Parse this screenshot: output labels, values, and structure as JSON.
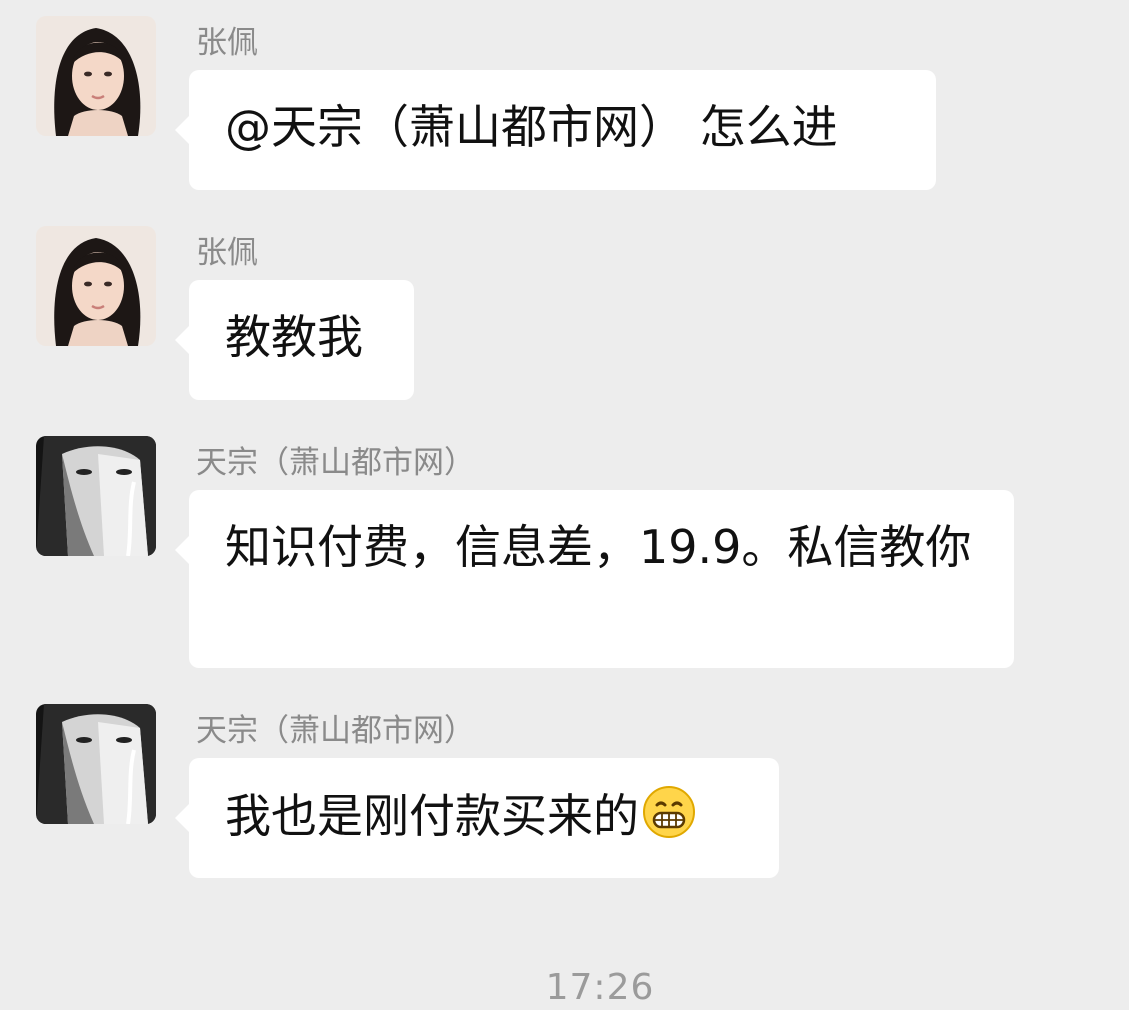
{
  "chat": {
    "messages": [
      {
        "sender": "张佩",
        "avatar": "female-avatar",
        "text": "@天宗（萧山都市网） 怎么进"
      },
      {
        "sender": "张佩",
        "avatar": "female-avatar",
        "text": "教教我"
      },
      {
        "sender": "天宗（萧山都市网）",
        "avatar": "masked-face-avatar",
        "text": "知识付费，信息差，19.9。私信教你"
      },
      {
        "sender": "天宗（萧山都市网）",
        "avatar": "masked-face-avatar",
        "text": "我也是刚付款买来的",
        "emoji": "grinning-emoji-icon"
      }
    ],
    "timestamp": "17:26"
  },
  "colors": {
    "background": "#ededed",
    "bubble": "#ffffff",
    "sender_name": "#8a8a8a",
    "message_text": "#111111",
    "timestamp": "#9b9b9b"
  }
}
